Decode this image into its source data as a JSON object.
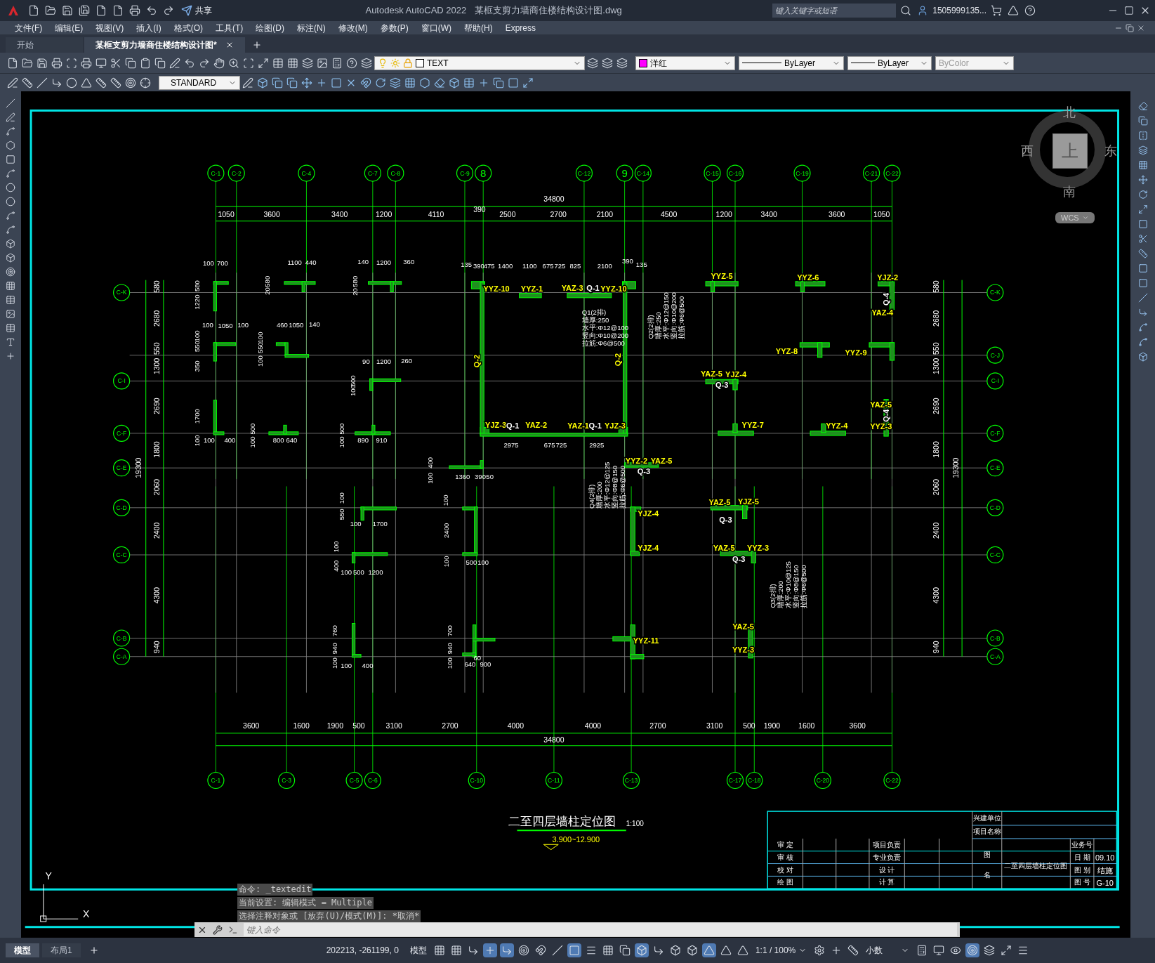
{
  "title_bar": {
    "share": "共享",
    "app_title": "Autodesk AutoCAD 2022",
    "file_name": "某框支剪力墙商住楼结构设计图.dwg",
    "search": {
      "placeholder": "键入关键字或短语"
    },
    "user": "1505999135..."
  },
  "menu": [
    "文件(F)",
    "编辑(E)",
    "视图(V)",
    "插入(I)",
    "格式(O)",
    "工具(T)",
    "绘图(D)",
    "标注(N)",
    "修改(M)",
    "参数(P)",
    "窗口(W)",
    "帮助(H)",
    "Express"
  ],
  "doc_tabs": [
    {
      "label": "开始",
      "selected": false
    },
    {
      "label": "某框支剪力墙商住楼结构设计图*",
      "selected": true
    }
  ],
  "properties": {
    "layer": "TEXT",
    "color": {
      "label": "洋红",
      "color": "#ff00ff"
    },
    "linetype": "ByLayer",
    "lineweight": "ByLayer",
    "plot_style": {
      "value": "ByColor",
      "disabled": true
    }
  },
  "text_style": "STANDARD",
  "drawing": {
    "top_axes": [
      "C-1",
      "C-2",
      "C-4",
      "C-7",
      "C-8",
      "C-9",
      "8",
      "C-12",
      "9",
      "C-14",
      "C-15",
      "C-16",
      "C-19",
      "C-21",
      "C-22"
    ],
    "bottom_axes": [
      "C-1",
      "C-3",
      "C-5",
      "C-6",
      "C-10",
      "C-11",
      "C-13",
      "C-17",
      "C-18",
      "C-20",
      "C-22"
    ],
    "left_axes": [
      "C-K",
      "C-I",
      "C-F",
      "C-E",
      "C-D",
      "C-C",
      "C-B",
      "C-A"
    ],
    "right_axes": [
      "C-K",
      "C-J",
      "C-I",
      "C-F",
      "C-E",
      "C-D",
      "C-C",
      "C-B",
      "C-A"
    ],
    "top_total": "34800",
    "top_dims": [
      "1050",
      "3600",
      "3400",
      "1200",
      "4110",
      "390",
      "2500",
      "2700",
      "2100",
      "4500",
      "1200",
      "3400",
      "3600",
      "1050"
    ],
    "bottom_dims": [
      "3600",
      "1600",
      "1900",
      "500",
      "3100",
      "2700",
      "4000",
      "4000",
      "2700",
      "3100",
      "500",
      "1900",
      "1600",
      "3600"
    ],
    "bottom_total": "34800",
    "left_total": "19300",
    "left_dims": [
      "580",
      "2680",
      "550",
      "1300",
      "2690",
      "1800",
      "2060",
      "2400",
      "4300",
      "940"
    ],
    "right_total": "19300",
    "right_dims": [
      "580",
      "2680",
      "550",
      "1300",
      "2690",
      "1800",
      "2060",
      "2400",
      "4300",
      "940"
    ],
    "labels": [
      {
        "text": "YYZ-10",
        "color": "#ffff00"
      },
      {
        "text": "YYZ-1",
        "color": "#ffff00"
      },
      {
        "text": "YAZ-3",
        "color": "#ffff00"
      },
      {
        "text": "Q-1",
        "color": "#ffffff"
      },
      {
        "text": "YYZ-10",
        "color": "#ffff00"
      },
      {
        "text": "YYZ-5",
        "color": "#ffff00"
      },
      {
        "text": "YYZ-6",
        "color": "#ffff00"
      },
      {
        "text": "YJZ-2",
        "color": "#ffff00"
      },
      {
        "text": "Q-4",
        "color": "#ffffff"
      },
      {
        "text": "YAZ-4",
        "color": "#ffff00"
      },
      {
        "text": "YYZ-8",
        "color": "#ffff00"
      },
      {
        "text": "YYZ-9",
        "color": "#ffff00"
      },
      {
        "text": "YAZ-5",
        "color": "#ffff00"
      },
      {
        "text": "YJZ-4",
        "color": "#ffff00"
      },
      {
        "text": "Q-3",
        "color": "#ffffff"
      },
      {
        "text": "YJZ-3",
        "color": "#ffff00"
      },
      {
        "text": "Q-1",
        "color": "#ffffff"
      },
      {
        "text": "YAZ-2",
        "color": "#ffff00"
      },
      {
        "text": "YAZ-1",
        "color": "#ffff00"
      },
      {
        "text": "Q-1",
        "color": "#ffffff"
      },
      {
        "text": "YJZ-3",
        "color": "#ffff00"
      },
      {
        "text": "YYZ-7",
        "color": "#ffff00"
      },
      {
        "text": "YYZ-4",
        "color": "#ffff00"
      },
      {
        "text": "YAZ-5",
        "color": "#ffff00"
      },
      {
        "text": "Q-4",
        "color": "#ffffff"
      },
      {
        "text": "YYZ-3",
        "color": "#ffff00"
      },
      {
        "text": "YYZ-2",
        "color": "#ffff00"
      },
      {
        "text": "YAZ-5",
        "color": "#ffff00"
      },
      {
        "text": "Q-3",
        "color": "#ffffff"
      },
      {
        "text": "YJZ-4",
        "color": "#ffff00"
      },
      {
        "text": "YJZ-4",
        "color": "#ffff00"
      },
      {
        "text": "YAZ-5",
        "color": "#ffff00"
      },
      {
        "text": "YJZ-5",
        "color": "#ffff00"
      },
      {
        "text": "Q-3",
        "color": "#ffffff"
      },
      {
        "text": "YAZ-5",
        "color": "#ffff00"
      },
      {
        "text": "YYZ-3",
        "color": "#ffff00"
      },
      {
        "text": "Q-3",
        "color": "#ffffff"
      },
      {
        "text": "YYZ-11",
        "color": "#ffff00"
      },
      {
        "text": "YAZ-5",
        "color": "#ffff00"
      },
      {
        "text": "YYZ-3",
        "color": "#ffff00"
      },
      {
        "text": "Q-2",
        "color": "#ffff00"
      },
      {
        "text": "Q-2",
        "color": "#ffff00"
      }
    ],
    "dims": [
      "100",
      "700",
      "1100",
      "440",
      "140",
      "1200",
      "360",
      "135",
      "390",
      "475",
      "1400",
      "1100",
      "675",
      "725",
      "825",
      "2100",
      "390",
      "135",
      "100",
      "1050",
      "100",
      "460",
      "1050",
      "140",
      "90",
      "1200",
      "260",
      "100",
      "400",
      "800",
      "640",
      "890",
      "910",
      "2975",
      "675",
      "725",
      "2925",
      "1360",
      "390",
      "50",
      "100",
      "1700",
      "100",
      "500",
      "1200",
      "500",
      "100",
      "100",
      "400",
      "640",
      "900",
      "60",
      "1220",
      "580",
      "550",
      "100",
      "350",
      "1700",
      "100",
      "20",
      "580",
      "550",
      "100",
      "100",
      "500",
      "100",
      "500",
      "100",
      "20",
      "580",
      "500",
      "100",
      "400",
      "100",
      "550",
      "100",
      "100",
      "400",
      "100",
      "2400",
      "100",
      "760",
      "940",
      "100",
      "700",
      "940",
      "100"
    ],
    "notes": [
      [
        "Q1(2排)",
        "墙厚:250",
        "水平:Φ12@100",
        "竖向:Φ10@200",
        "拉筋:Φ6@500"
      ],
      [
        "Q2(2排)",
        "墙厚:250",
        "水平:Φ12@150",
        "竖向:Φ10@200",
        "拉筋:Φ6@500"
      ],
      [
        "Q4(2排)",
        "墙厚:200",
        "水平:Φ12@125",
        "竖向:Φ8@150",
        "拉筋:Φ6@500"
      ],
      [
        "Q3(2排)",
        "墙厚:200",
        "水平:Φ10@125",
        "竖向:Φ8@150",
        "拉筋:Φ6@500"
      ]
    ],
    "title": "二至四层墙柱定位图",
    "scale": "1:100",
    "elevation": "3.900~12.900",
    "title_block": {
      "owner_label": "兴建单位",
      "project_label": "项目名称",
      "left_labels": [
        "审 定",
        "审 核",
        "校 对",
        "绘 图"
      ],
      "mid_labels": [
        "项目负责",
        "专业负责",
        "设 计",
        "计 算"
      ],
      "name_label": [
        "图",
        "名"
      ],
      "drawing_name": "二至四层墙柱定位图",
      "right_labels": [
        "业务号",
        "日 期",
        "图 别",
        "图 号"
      ],
      "right_values": [
        "09.10",
        "结施",
        "G-10"
      ]
    }
  },
  "viewcube": {
    "north": "北",
    "east": "东",
    "south": "南",
    "west": "西",
    "face": "上",
    "ucs": "WCS"
  },
  "ucs_icon": {
    "x": "X",
    "y": "Y"
  },
  "command_history": [
    "命令: _textedit",
    "当前设置: 编辑模式 = Multiple",
    "选择注释对象或 [放弃(U)/模式(M)]: *取消*"
  ],
  "command_input": {
    "placeholder": "键入命令"
  },
  "layout_tabs": [
    {
      "label": "模型",
      "selected": true
    },
    {
      "label": "布局1",
      "selected": false
    }
  ],
  "status": {
    "coords": "202213, -261199, 0",
    "space": "模型",
    "scale": "1:1 / 100%",
    "units": "小数"
  }
}
